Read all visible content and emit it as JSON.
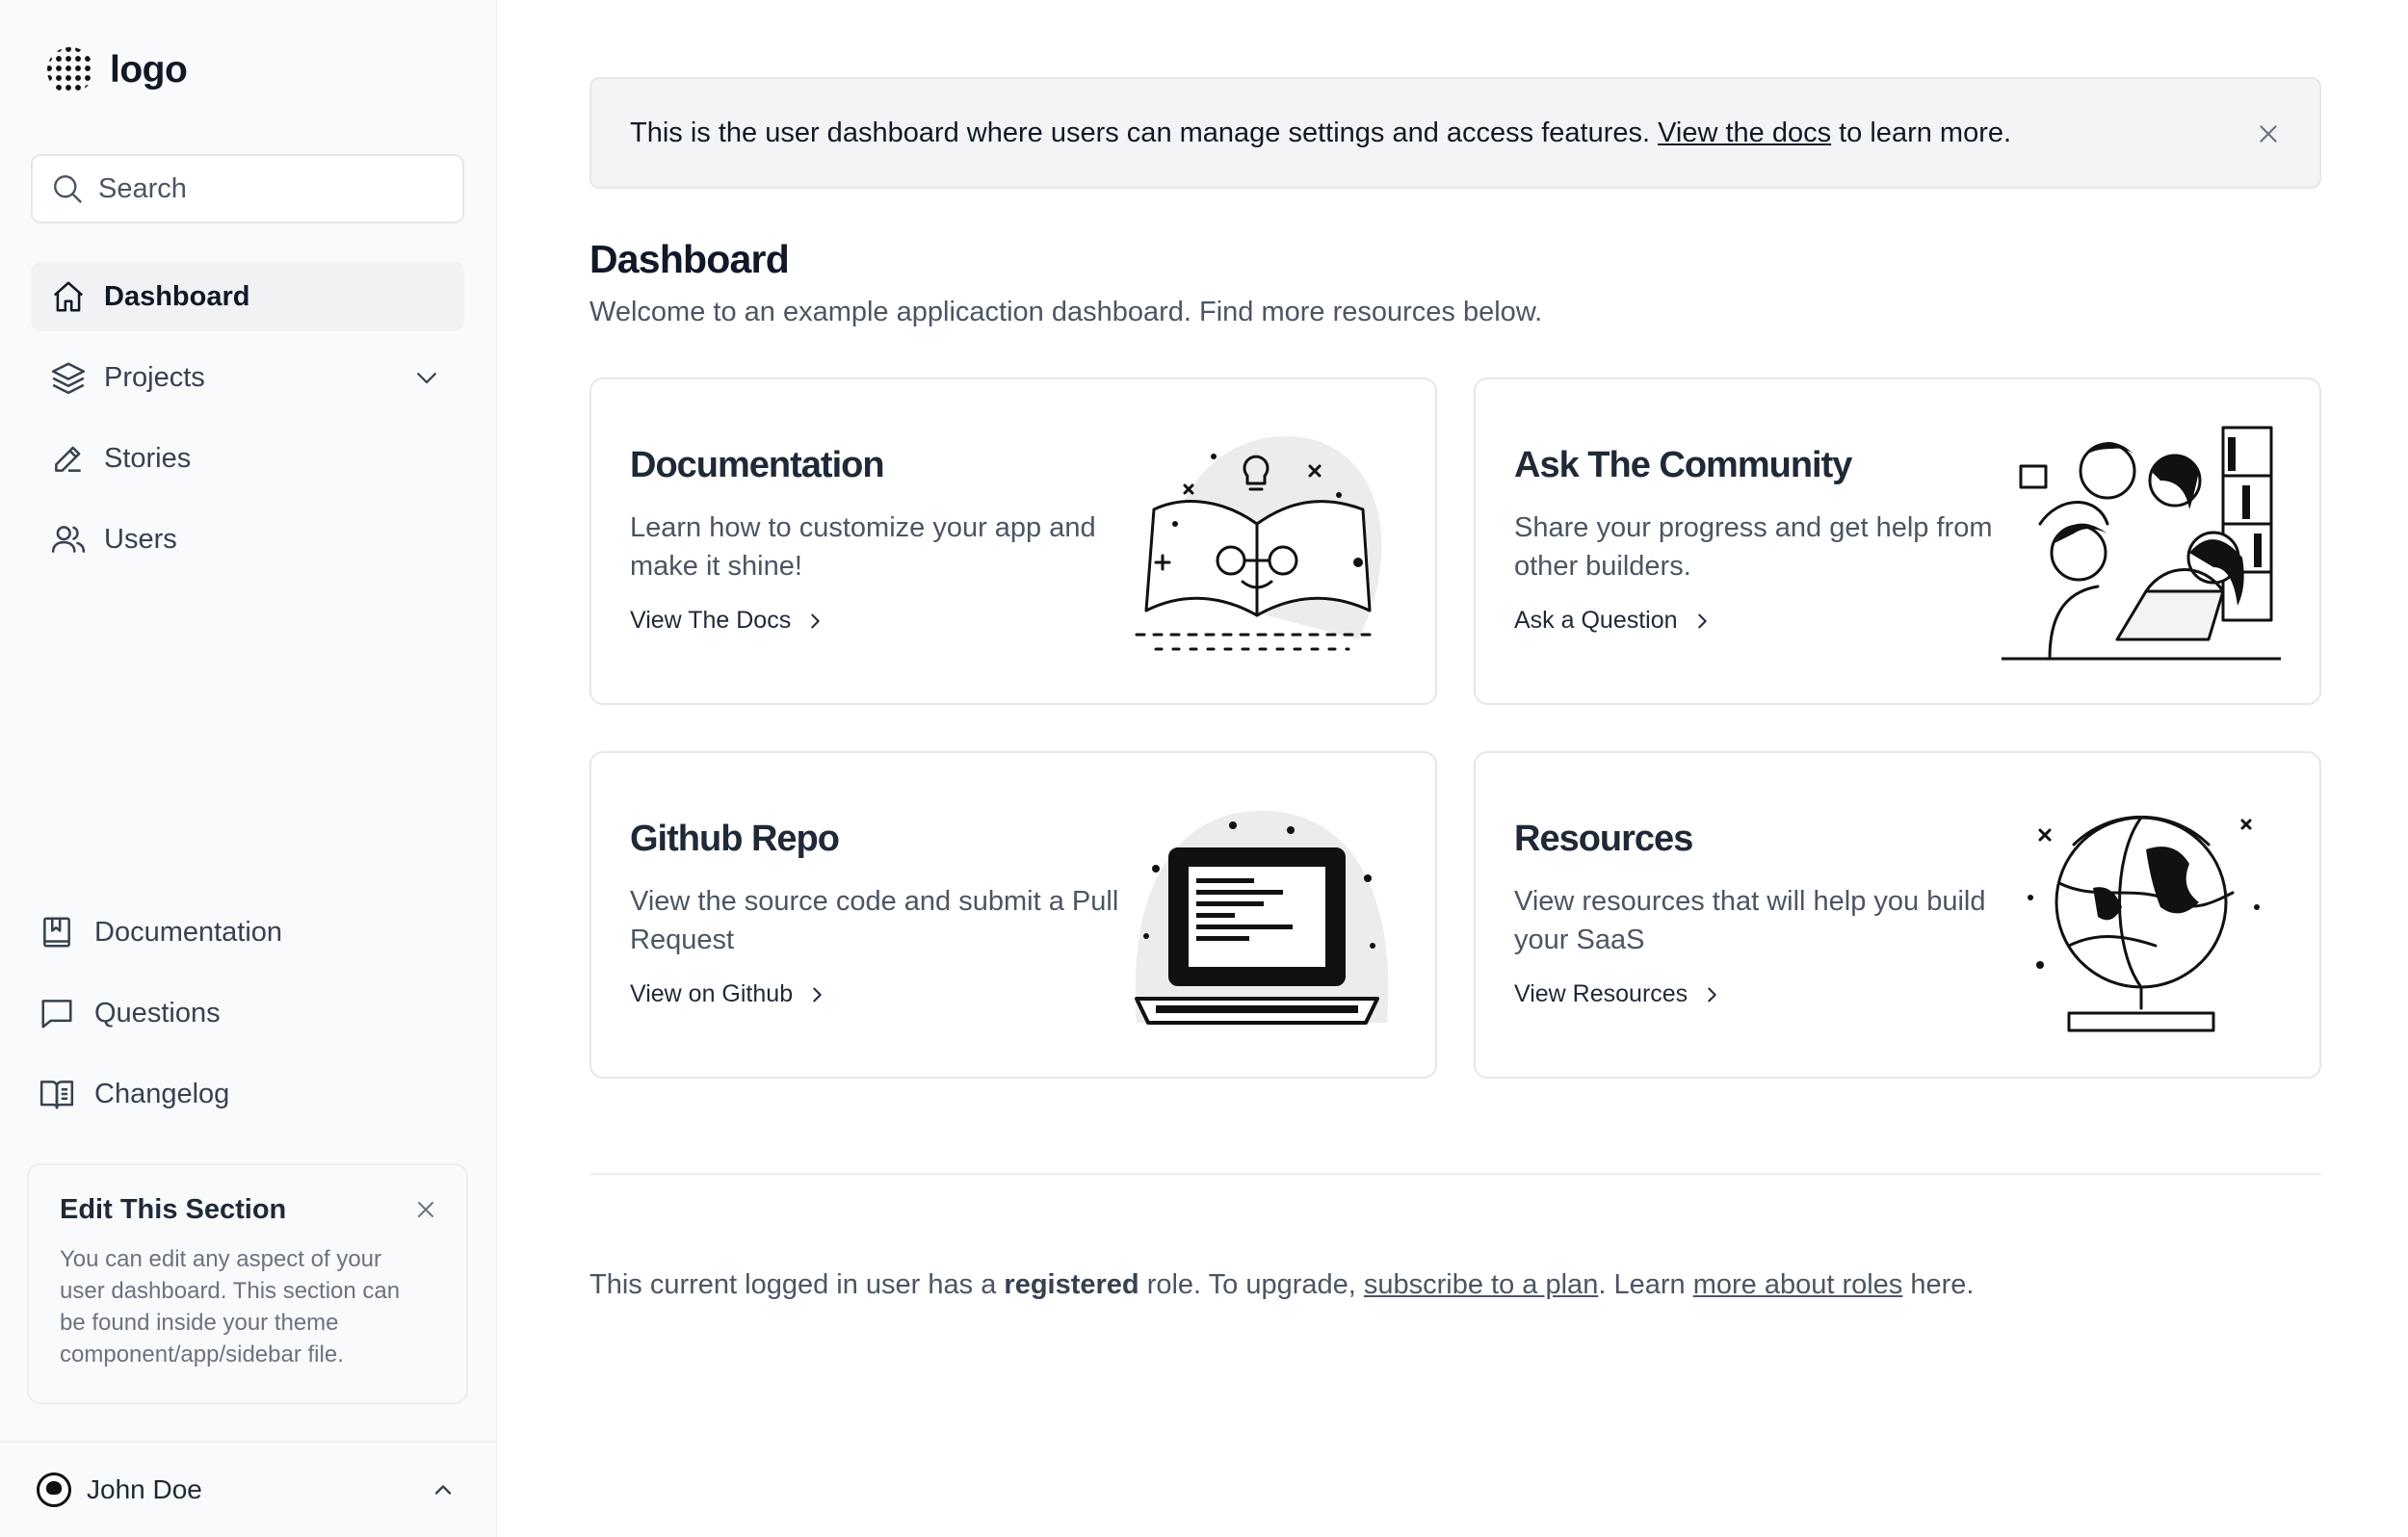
{
  "app": {
    "logo_text": "logo"
  },
  "search": {
    "placeholder": "Search"
  },
  "sidebar": {
    "items": [
      {
        "label": "Dashboard",
        "icon": "home-icon",
        "active": true
      },
      {
        "label": "Projects",
        "icon": "layers-icon"
      },
      {
        "label": "Stories",
        "icon": "pencil-icon"
      },
      {
        "label": "Users",
        "icon": "users-icon"
      }
    ],
    "secondary": [
      {
        "label": "Documentation",
        "icon": "book-bookmark-icon"
      },
      {
        "label": "Questions",
        "icon": "chat-bubble-icon"
      },
      {
        "label": "Changelog",
        "icon": "open-book-icon"
      }
    ],
    "edit_card": {
      "title": "Edit This Section",
      "body": "You can edit any aspect of your user dashboard. This section can be found inside your theme component/app/sidebar file."
    },
    "user": {
      "name": "John Doe"
    }
  },
  "alert": {
    "text_before": "This is the user dashboard where users can manage settings and access features.",
    "link": "View the docs",
    "text_after": "to learn more."
  },
  "page": {
    "title": "Dashboard",
    "subtitle": "Welcome to an example applicaction dashboard. Find more resources below."
  },
  "cards": [
    {
      "title": "Documentation",
      "description": "Learn how to customize your app and make it shine!",
      "link": "View The Docs",
      "illustration": "open-book-illustration"
    },
    {
      "title": "Ask The Community",
      "description": "Share your progress and get help from other builders.",
      "link": "Ask a Question",
      "illustration": "people-group-illustration"
    },
    {
      "title": "Github Repo",
      "description": "View the source code and submit a Pull Request",
      "link": "View on Github",
      "illustration": "laptop-illustration"
    },
    {
      "title": "Resources",
      "description": "View resources that will help you build your SaaS",
      "link": "View Resources",
      "illustration": "globe-illustration"
    }
  ],
  "footer": {
    "t1": "This current logged in user has a",
    "role": "registered",
    "t2": "role. To upgrade,",
    "link1": "subscribe to a plan",
    "t3": ". Learn",
    "link2": "more about roles",
    "t4": "here."
  }
}
